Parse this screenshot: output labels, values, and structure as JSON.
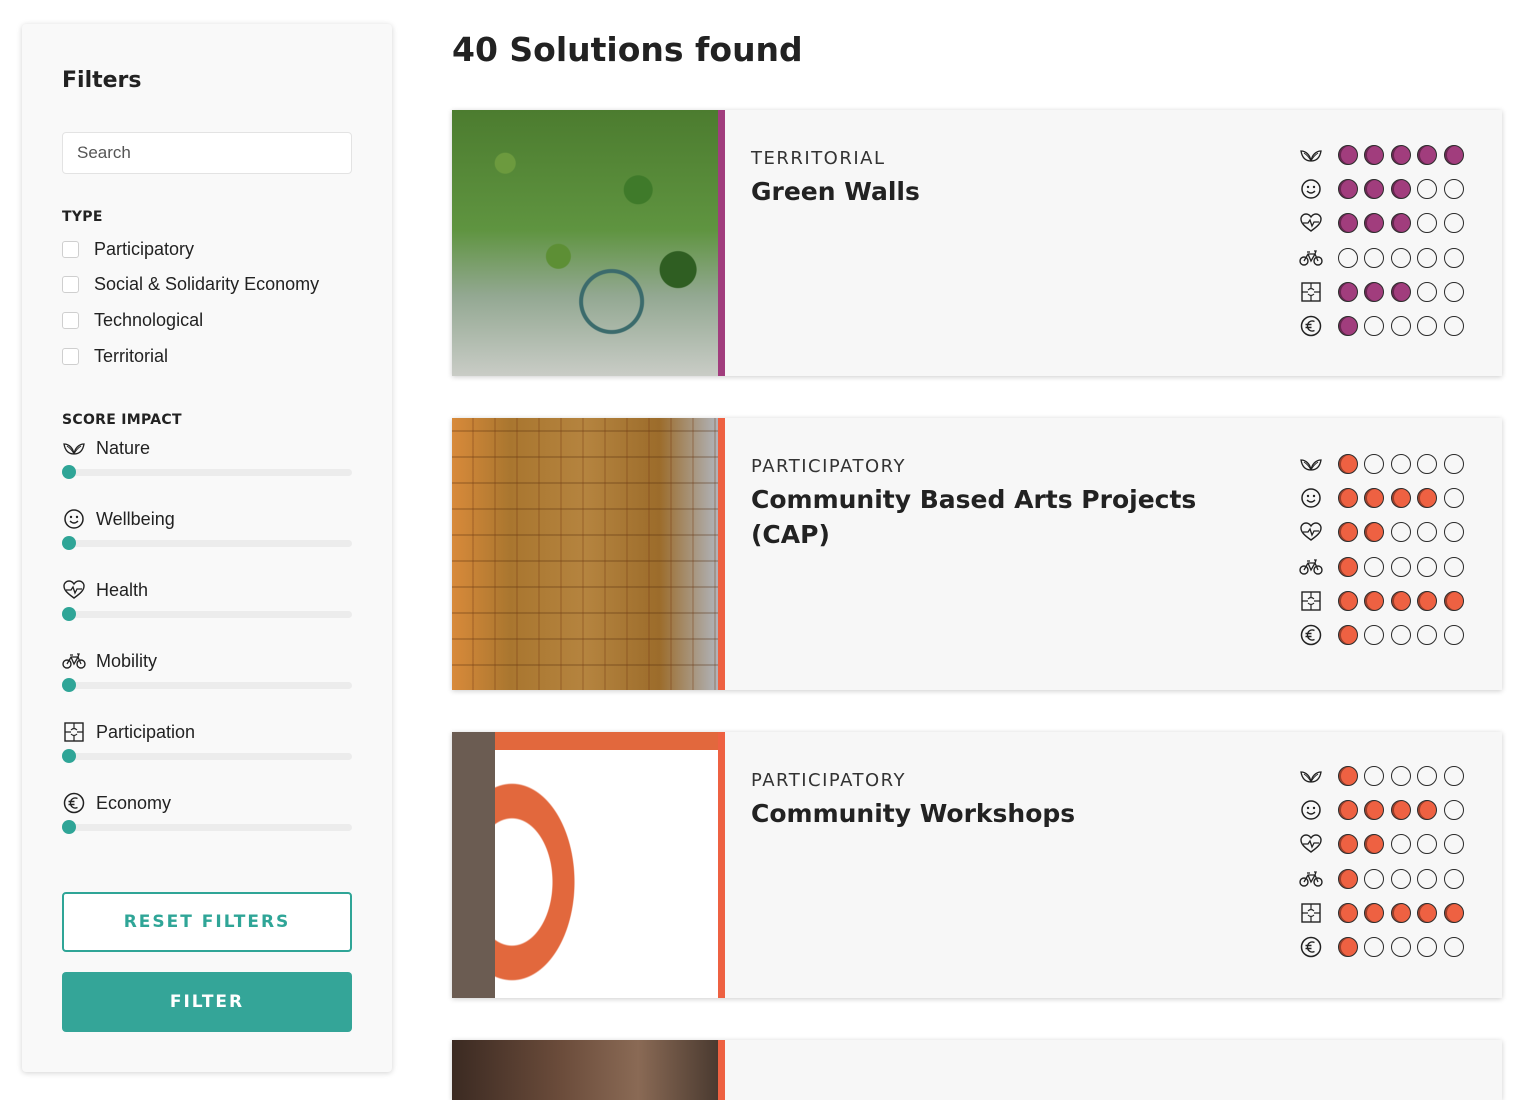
{
  "sidebar": {
    "title": "Filters",
    "search_placeholder": "Search",
    "type_heading": "TYPE",
    "types": [
      "Participatory",
      "Social & Solidarity Economy",
      "Technological",
      "Territorial"
    ],
    "score_heading": "SCORE IMPACT",
    "sliders": [
      {
        "label": "Nature",
        "icon": "leaf-icon",
        "value": 0
      },
      {
        "label": "Wellbeing",
        "icon": "smiley-icon",
        "value": 0
      },
      {
        "label": "Health",
        "icon": "heart-pulse-icon",
        "value": 0
      },
      {
        "label": "Mobility",
        "icon": "bicycle-icon",
        "value": 0
      },
      {
        "label": "Participation",
        "icon": "puzzle-icon",
        "value": 0
      },
      {
        "label": "Economy",
        "icon": "euro-icon",
        "value": 0
      }
    ],
    "reset_label": "RESET FILTERS",
    "filter_label": "FILTER"
  },
  "results_title": "40 Solutions found",
  "score_icons": [
    "leaf-icon",
    "smiley-icon",
    "heart-pulse-icon",
    "bicycle-icon",
    "puzzle-icon",
    "euro-icon"
  ],
  "cards": [
    {
      "type": "TERRITORIAL",
      "title": "Green Walls",
      "color": "#a13d7d",
      "image": "green-wall-photo",
      "scores": [
        5,
        3,
        3,
        0,
        3,
        1
      ]
    },
    {
      "type": "PARTICIPATORY",
      "title": "Community Based Arts Projects (CAP)",
      "color": "#ee6142",
      "image": "arts-wall-photo",
      "scores": [
        1,
        4,
        2,
        1,
        5,
        1
      ]
    },
    {
      "type": "PARTICIPATORY",
      "title": "Community Workshops",
      "color": "#ee6142",
      "image": "workshop-poster",
      "scores": [
        1,
        4,
        2,
        1,
        5,
        1
      ]
    }
  ],
  "colors": {
    "accent": "#2fa597",
    "territorial": "#a13d7d",
    "participatory": "#ee6142"
  }
}
